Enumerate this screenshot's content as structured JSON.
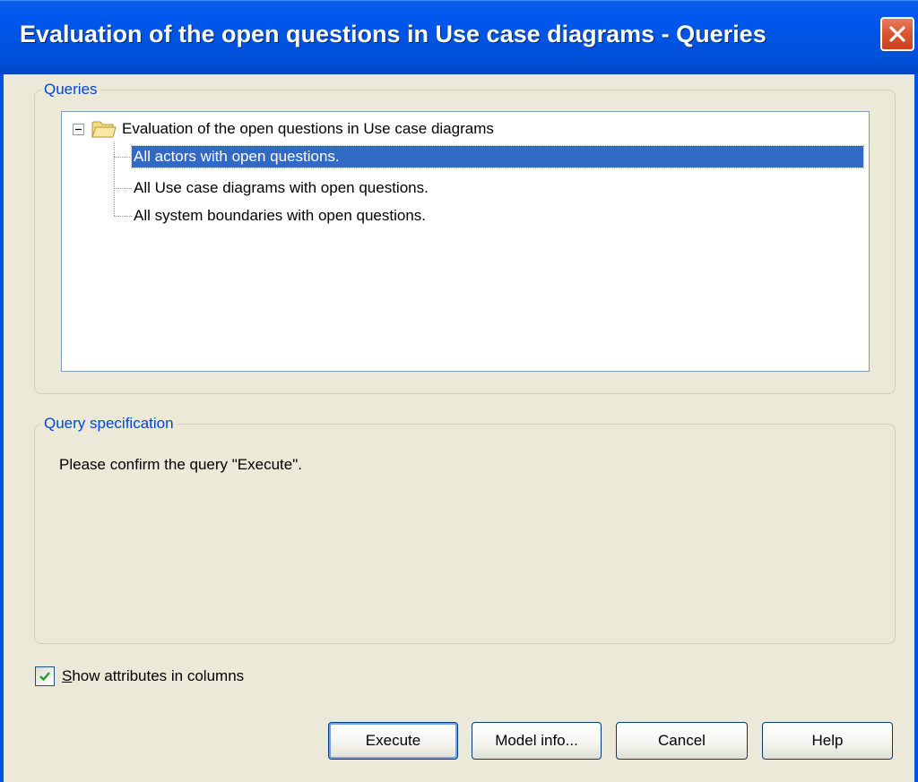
{
  "window": {
    "title": "Evaluation of the open questions in Use case diagrams - Queries",
    "close_icon": "close-icon"
  },
  "queries_group": {
    "label": "Queries",
    "tree": {
      "root": {
        "label": "Evaluation of the open questions in Use case diagrams",
        "expanded": true,
        "icon": "folder-open-icon"
      },
      "items": [
        {
          "label": "All actors with open questions.",
          "selected": true
        },
        {
          "label": "All Use case diagrams with open questions.",
          "selected": false
        },
        {
          "label": "All system boundaries with open questions.",
          "selected": false
        }
      ]
    }
  },
  "spec_group": {
    "label": "Query specification",
    "text": "Please confirm the query \"Execute\"."
  },
  "options": {
    "show_attributes_label": "Show attributes in columns",
    "show_attributes_checked": true
  },
  "buttons": {
    "execute": "Execute",
    "model_info": "Model info...",
    "cancel": "Cancel",
    "help": "Help"
  },
  "colors": {
    "titlebar": "#0054e3",
    "selection": "#316ac5",
    "group_label": "#0046d5",
    "dialog_bg": "#ece9d8"
  }
}
